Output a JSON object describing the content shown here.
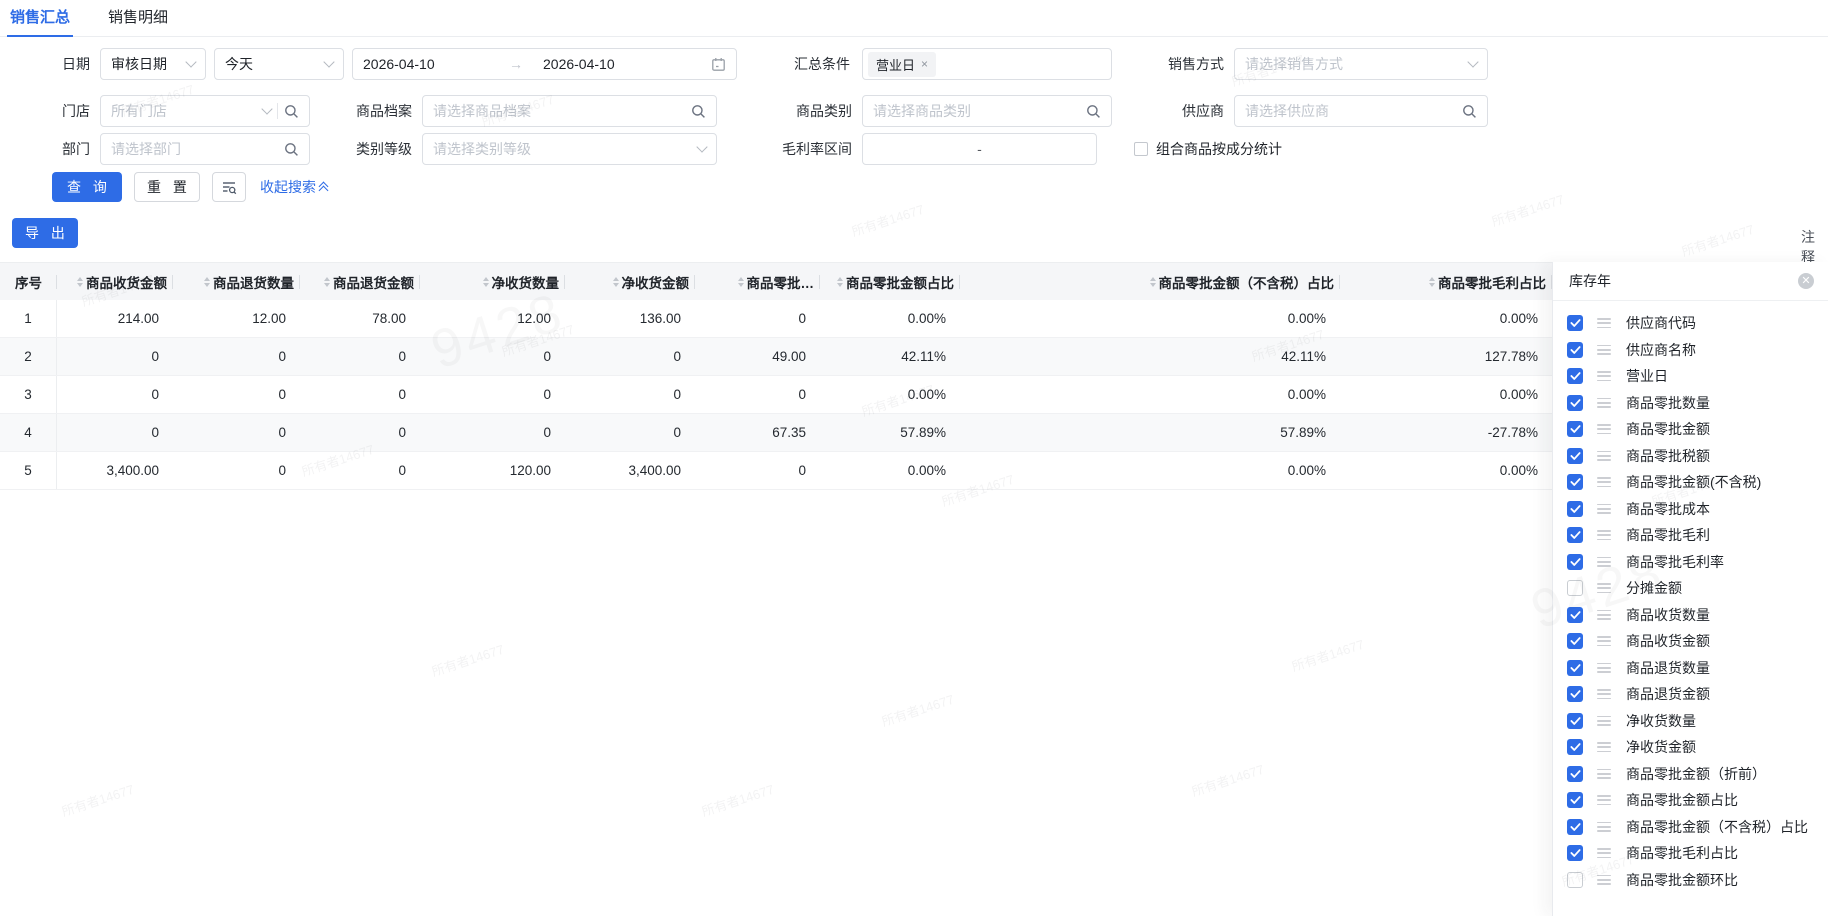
{
  "colors": {
    "accent": "#2e6ce6"
  },
  "tabs": [
    {
      "label": "销售汇总",
      "active": true
    },
    {
      "label": "销售明细",
      "active": false
    }
  ],
  "filters": {
    "date": {
      "label": "日期",
      "type_value": "审核日期",
      "preset_value": "今天",
      "start": "2026-04-10",
      "end": "2026-04-10",
      "arrow": "→"
    },
    "summary_condition": {
      "label": "汇总条件",
      "tag": "营业日",
      "tag_close": "×"
    },
    "sales_mode": {
      "label": "销售方式",
      "placeholder": "请选择销售方式"
    },
    "store": {
      "label": "门店",
      "placeholder": "所有门店"
    },
    "product_archive": {
      "label": "商品档案",
      "placeholder": "请选择商品档案"
    },
    "product_category": {
      "label": "商品类别",
      "placeholder": "请选择商品类别"
    },
    "supplier": {
      "label": "供应商",
      "placeholder": "请选择供应商"
    },
    "department": {
      "label": "部门",
      "placeholder": "请选择部门"
    },
    "category_level": {
      "label": "类别等级",
      "placeholder": "请选择类别等级"
    },
    "gross_margin_range": {
      "label": "毛利率区间",
      "separator": "-"
    },
    "combo_stat": {
      "label": "组合商品按成分统计",
      "checked": false
    }
  },
  "actions": {
    "query": "查 询",
    "reset": "重 置",
    "collapse": "收起搜索",
    "export": "导 出"
  },
  "note_label": "注释",
  "table": {
    "columns": [
      "序号",
      "商品收货金额",
      "商品退货数量",
      "商品退货金额",
      "净收货数量",
      "净收货金额",
      "商品零批…",
      "商品零批金额占比",
      "商品零批金额（不含税）占比",
      "商品零批毛利占比"
    ],
    "rows": [
      [
        "1",
        "214.00",
        "12.00",
        "78.00",
        "12.00",
        "136.00",
        "0",
        "0.00%",
        "0.00%",
        "0.00%"
      ],
      [
        "2",
        "0",
        "0",
        "0",
        "0",
        "0",
        "49.00",
        "42.11%",
        "42.11%",
        "127.78%"
      ],
      [
        "3",
        "0",
        "0",
        "0",
        "0",
        "0",
        "0",
        "0.00%",
        "0.00%",
        "0.00%"
      ],
      [
        "4",
        "0",
        "0",
        "0",
        "0",
        "0",
        "67.35",
        "57.89%",
        "57.89%",
        "-27.78%"
      ],
      [
        "5",
        "3,400.00",
        "0",
        "0",
        "120.00",
        "3,400.00",
        "0",
        "0.00%",
        "0.00%",
        "0.00%"
      ]
    ]
  },
  "column_panel": {
    "search_value": "库存年",
    "items": [
      {
        "label": "供应商代码",
        "checked": true
      },
      {
        "label": "供应商名称",
        "checked": true
      },
      {
        "label": "营业日",
        "checked": true
      },
      {
        "label": "商品零批数量",
        "checked": true
      },
      {
        "label": "商品零批金额",
        "checked": true
      },
      {
        "label": "商品零批税额",
        "checked": true
      },
      {
        "label": "商品零批金额(不含税)",
        "checked": true
      },
      {
        "label": "商品零批成本",
        "checked": true
      },
      {
        "label": "商品零批毛利",
        "checked": true
      },
      {
        "label": "商品零批毛利率",
        "checked": true
      },
      {
        "label": "分摊金额",
        "checked": false
      },
      {
        "label": "商品收货数量",
        "checked": true
      },
      {
        "label": "商品收货金额",
        "checked": true
      },
      {
        "label": "商品退货数量",
        "checked": true
      },
      {
        "label": "商品退货金额",
        "checked": true
      },
      {
        "label": "净收货数量",
        "checked": true
      },
      {
        "label": "净收货金额",
        "checked": true
      },
      {
        "label": "商品零批金额（折前）",
        "checked": true
      },
      {
        "label": "商品零批金额占比",
        "checked": true
      },
      {
        "label": "商品零批金额（不含税）占比",
        "checked": true
      },
      {
        "label": "商品零批毛利占比",
        "checked": true
      },
      {
        "label": "商品零批金额环比",
        "checked": false
      }
    ]
  },
  "watermark": {
    "text": "所有者14677",
    "big_text": "9428"
  }
}
